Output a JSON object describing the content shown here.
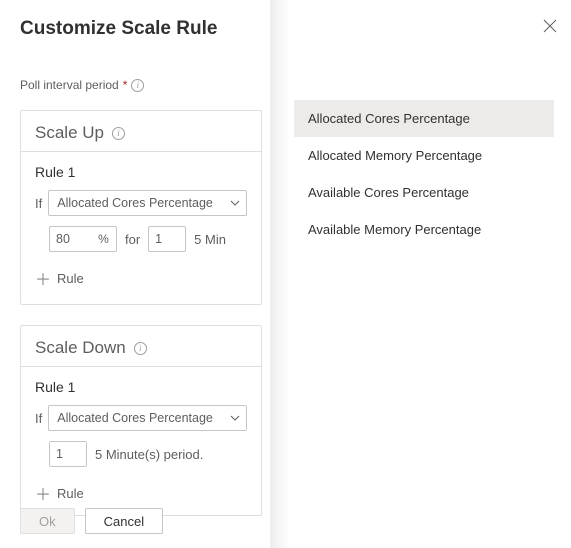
{
  "header": {
    "title": "Customize Scale Rule"
  },
  "poll": {
    "label": "Poll interval period",
    "required": "*"
  },
  "scaleUp": {
    "title": "Scale Up",
    "rule": {
      "title": "Rule 1",
      "ifLabel": "If",
      "metric": "Allocated Cores Percentage",
      "threshold": "80",
      "percentSuffix": "%",
      "forLabel": "for",
      "periodCount": "1",
      "periodSuffix": "5 Min"
    },
    "addRule": "Rule"
  },
  "scaleDown": {
    "title": "Scale Down",
    "rule": {
      "title": "Rule 1",
      "ifLabel": "If",
      "metric": "Allocated Cores Percentage",
      "periodCount": "1",
      "periodSuffix": "5 Minute(s) period."
    },
    "addRule": "Rule"
  },
  "footer": {
    "ok": "Ok",
    "cancel": "Cancel"
  },
  "menu": {
    "items": [
      "Allocated Cores Percentage",
      "Allocated Memory Percentage",
      "Available Cores Percentage",
      "Available Memory Percentage"
    ]
  }
}
